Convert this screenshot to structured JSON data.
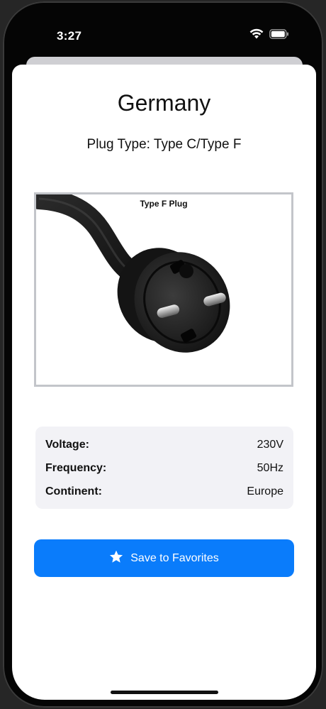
{
  "status_bar": {
    "time": "3:27",
    "wifi_icon": "wifi-icon",
    "battery_icon": "battery-icon"
  },
  "detail": {
    "country": "Germany",
    "plug_type": "Plug Type: Type C/Type F",
    "image": {
      "caption": "Type F Plug",
      "icon": "type-f-plug-illustration"
    },
    "specs": [
      {
        "label": "Voltage:",
        "value": "230V"
      },
      {
        "label": "Frequency:",
        "value": "50Hz"
      },
      {
        "label": "Continent:",
        "value": "Europe"
      }
    ],
    "save_button": {
      "label": "Save to Favorites",
      "icon": "star-icon"
    }
  },
  "colors": {
    "accent": "#0a7cfb",
    "card_background": "#f2f2f6",
    "image_border": "#c3c5ca"
  }
}
